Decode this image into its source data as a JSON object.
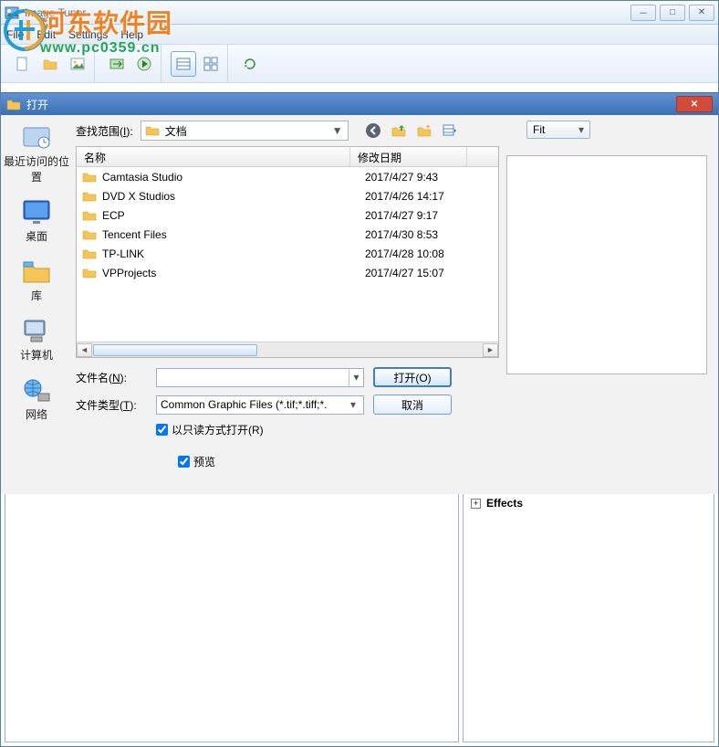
{
  "app": {
    "title": "Image Tuner"
  },
  "menu": {
    "file": "File",
    "edit": "Edit",
    "settings": "Settings",
    "help": "Help"
  },
  "window_controls": {
    "min": "－",
    "max": "□",
    "close": "✕"
  },
  "dialog": {
    "title": "打开",
    "lookin_label_pre": "查找范围(",
    "lookin_label_key": "I",
    "lookin_label_post": "):",
    "lookin_value": "文档",
    "places": {
      "recent": "最近访问的位置",
      "desktop": "桌面",
      "libraries": "库",
      "computer": "计算机",
      "network": "网络"
    },
    "columns": {
      "name": "名称",
      "date": "修改日期"
    },
    "rows": [
      {
        "name": "Camtasia Studio",
        "date": "2017/4/27 9:43"
      },
      {
        "name": "DVD X Studios",
        "date": "2017/4/26 14:17"
      },
      {
        "name": "ECP",
        "date": "2017/4/27 9:17"
      },
      {
        "name": "Tencent Files",
        "date": "2017/4/30 8:53"
      },
      {
        "name": "TP-LINK",
        "date": "2017/4/28 10:08"
      },
      {
        "name": "VPProjects",
        "date": "2017/4/27 15:07"
      }
    ],
    "filename_label_pre": "文件名(",
    "filename_label_key": "N",
    "filename_label_post": "):",
    "filename_value": "",
    "filetype_label_pre": "文件类型(",
    "filetype_label_key": "T",
    "filetype_label_post": "):",
    "filetype_value": "Common Graphic Files (*.tif;*.tiff;*.",
    "readonly_label": "以只读方式打开(R)",
    "preview_label": "预览",
    "open_btn": "打开(O)",
    "cancel_btn": "取消",
    "fit_label": "Fit"
  },
  "effects": {
    "title": "Effects",
    "expander": "+"
  },
  "watermark": {
    "text": "河东软件园",
    "url": "www.pc0359.cn"
  }
}
